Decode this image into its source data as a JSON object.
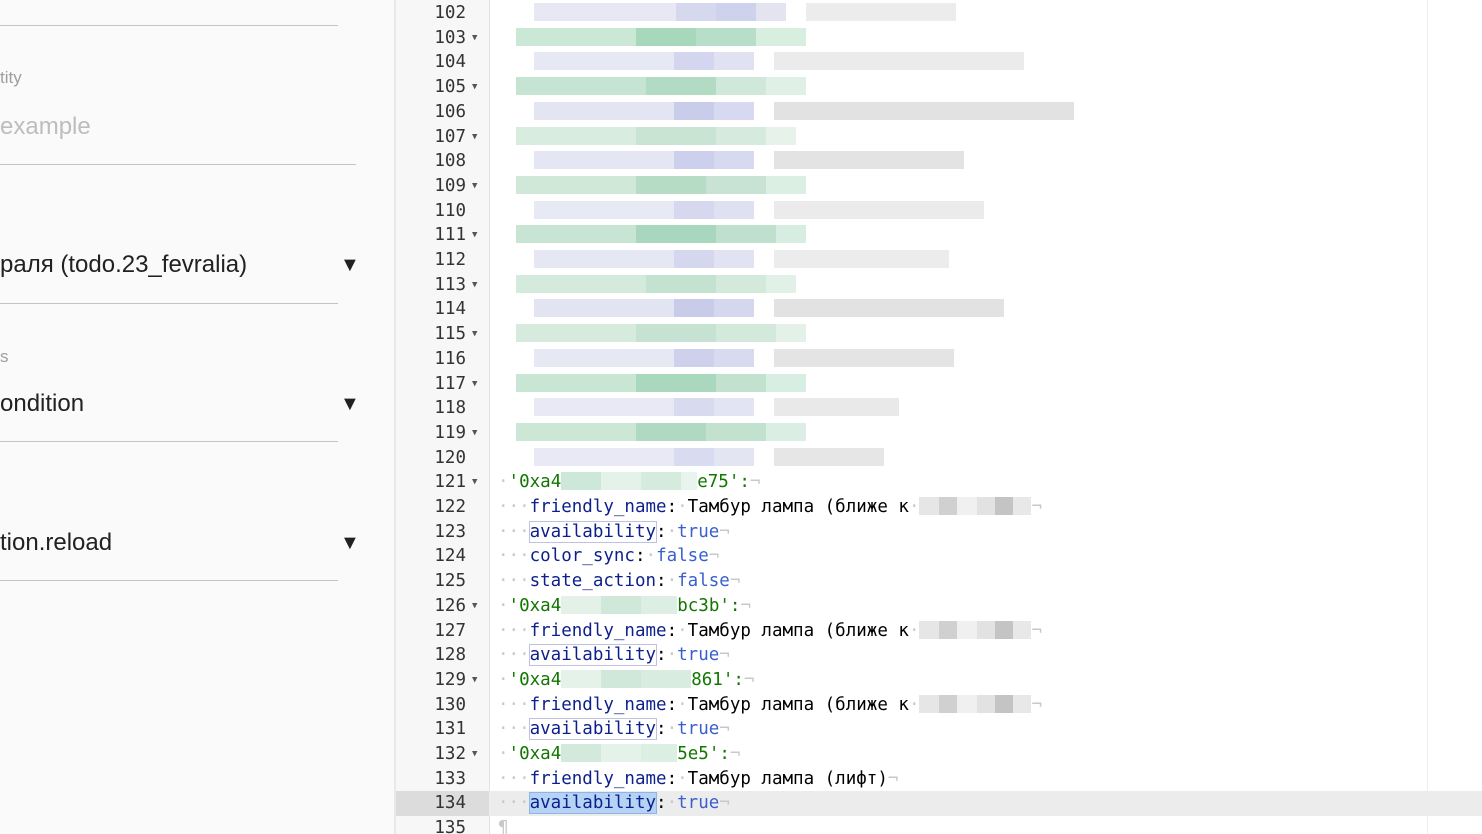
{
  "form": {
    "entity_label": "tity",
    "entity_placeholder": "example",
    "todo_select_value": "раля (todo.23_fevralia)",
    "conditions_label": "s",
    "condition_select_value": "ondition",
    "action_select_value": "tion.reload"
  },
  "editor": {
    "lines": [
      {
        "n": "102",
        "fold": false
      },
      {
        "n": "103",
        "fold": true
      },
      {
        "n": "104",
        "fold": false
      },
      {
        "n": "105",
        "fold": true
      },
      {
        "n": "106",
        "fold": false
      },
      {
        "n": "107",
        "fold": true
      },
      {
        "n": "108",
        "fold": false
      },
      {
        "n": "109",
        "fold": true
      },
      {
        "n": "110",
        "fold": false
      },
      {
        "n": "111",
        "fold": true
      },
      {
        "n": "112",
        "fold": false
      },
      {
        "n": "113",
        "fold": true
      },
      {
        "n": "114",
        "fold": false
      },
      {
        "n": "115",
        "fold": true
      },
      {
        "n": "116",
        "fold": false
      },
      {
        "n": "117",
        "fold": true
      },
      {
        "n": "118",
        "fold": false
      },
      {
        "n": "119",
        "fold": true
      },
      {
        "n": "120",
        "fold": false
      },
      {
        "n": "121",
        "fold": true
      },
      {
        "n": "122",
        "fold": false
      },
      {
        "n": "123",
        "fold": false
      },
      {
        "n": "124",
        "fold": false
      },
      {
        "n": "125",
        "fold": false
      },
      {
        "n": "126",
        "fold": true
      },
      {
        "n": "127",
        "fold": false
      },
      {
        "n": "128",
        "fold": false
      },
      {
        "n": "129",
        "fold": true
      },
      {
        "n": "130",
        "fold": false
      },
      {
        "n": "131",
        "fold": false
      },
      {
        "n": "132",
        "fold": true
      },
      {
        "n": "133",
        "fold": false
      },
      {
        "n": "134",
        "fold": false
      },
      {
        "n": "135",
        "fold": false
      }
    ],
    "code": {
      "l121_prefix": "'0xa4",
      "l121_suffix": "e75':",
      "l126_prefix": "'0xa4",
      "l126_suffix": "bc3b':",
      "l129_prefix": "'0xa4",
      "l129_suffix": "861':",
      "l132_prefix": "'0xa4",
      "l132_suffix": "5e5':",
      "friendly_name_key": "friendly_name",
      "availability_key": "availability",
      "color_sync_key": "color_sync",
      "state_action_key": "state_action",
      "colon": ":",
      "true_val": "true",
      "false_val": "false",
      "name_tambur_near": "Тамбур лампа (ближе к",
      "name_tambur_lift": "Тамбур лампа (лифт)"
    },
    "fold_glyph": "▼",
    "eol_glyph": "¬",
    "eof_glyph": "¶",
    "active_line": "134"
  },
  "colors": {
    "key": "#0d1f8c",
    "string": "#117700",
    "boolean": "#3a5fcf",
    "selection": "#b5d3f5"
  }
}
